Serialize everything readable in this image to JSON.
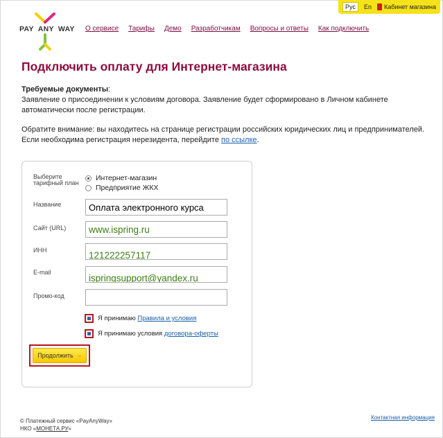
{
  "topbar": {
    "lang_ru": "Рус",
    "lang_en": "En",
    "cabinet": "Кабинет магазина"
  },
  "logo": {
    "text_1": "PAY",
    "text_2": "ANY",
    "text_3": "WAY"
  },
  "nav": [
    {
      "label": "О сервисе"
    },
    {
      "label": "Тарифы"
    },
    {
      "label": "Демо"
    },
    {
      "label": "Разработчикам"
    },
    {
      "label": "Вопросы и ответы"
    },
    {
      "label": "Как подключить"
    }
  ],
  "page_title": "Подключить оплату для Интернет-магазина",
  "documents": {
    "heading": "Требуемые документы",
    "text": "Заявление о присоединении к условиям договора. Заявление будет сформировано в Личном кабинете автоматически после регистрации."
  },
  "notice": {
    "text": "Обратите внимание: вы находитесь на странице регистрации российских юридических лиц и предпринимателей. Если необходима регистрация нерезидента, перейдите ",
    "link": "по ссылке",
    "end": "."
  },
  "form": {
    "tariff_label_1": "Выберите",
    "tariff_label_2": "тарифный план",
    "tariff_options": [
      {
        "label": "Интернет-магазин",
        "selected": true
      },
      {
        "label": "Предприятие ЖКХ",
        "selected": false
      }
    ],
    "name_label": "Название",
    "name_value": "Оплата электронного курса",
    "site_label": "Сайт (URL)",
    "site_value": "www.ispring.ru",
    "inn_label": "ИНН",
    "inn_value": "121222257117",
    "email_label": "E-mail",
    "email_value": "ispringsupport@yandex.ru",
    "promo_label": "Промо-код",
    "promo_value": "",
    "agree_rules_text": "Я принимаю ",
    "agree_rules_link": "Правила и условия",
    "agree_offer_text": "Я принимаю условия ",
    "agree_offer_link": "договора-оферты",
    "submit_label": "Продолжить",
    "submit_arrow": "→"
  },
  "footer": {
    "line1": "© Платежный сервис «PayAnyWay»",
    "line2_prefix": "НКО «",
    "line2_link": "МОНЕТА.РУ",
    "line2_suffix": "»",
    "contact": "Контактная информация"
  },
  "colors": {
    "brand_yellow": "#f6e21a",
    "title_maroon": "#8b0d3f",
    "link_blue": "#1a5fa8",
    "highlight_red": "#b5161e",
    "value_green": "#3d7d14"
  }
}
